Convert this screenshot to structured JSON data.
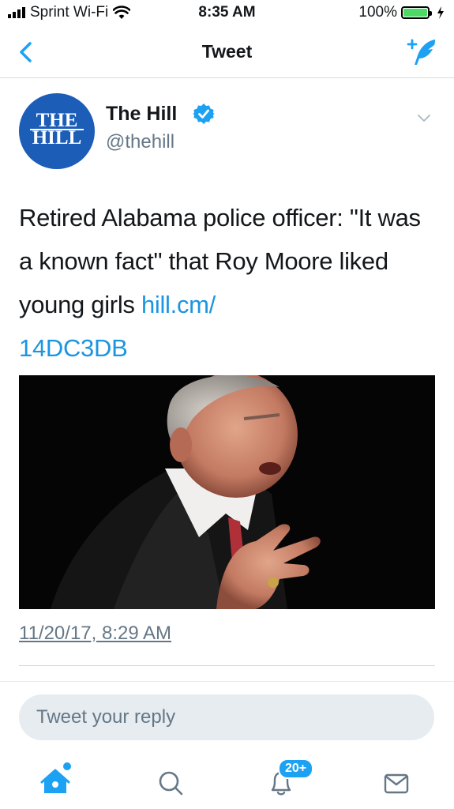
{
  "status_bar": {
    "carrier": "Sprint Wi-Fi",
    "time": "8:35 AM",
    "battery": "100%"
  },
  "nav": {
    "title": "Tweet",
    "back_icon": "chevron-left-icon",
    "compose_icon": "compose-tweet-icon"
  },
  "tweet": {
    "author_name": "The Hill",
    "handle": "@thehill",
    "avatar_line1": "THE",
    "avatar_line2": "HILL",
    "text": "Retired Alabama police officer: \"It was a known fact\" that Roy Moore liked young girls ",
    "link_part1": "hill.cm/",
    "link_part2": "14DC3DB",
    "timestamp": "11/20/17, 8:29 AM"
  },
  "reply": {
    "placeholder": "Tweet your reply"
  },
  "tab_bar": {
    "notification_badge": "20+",
    "tabs": [
      "home-icon",
      "search-icon",
      "notifications-icon",
      "messages-icon"
    ]
  },
  "colors": {
    "accent": "#1da1f2",
    "link": "#1b95e0",
    "secondary_text": "#657786",
    "avatar_bg": "#1c5db7"
  }
}
